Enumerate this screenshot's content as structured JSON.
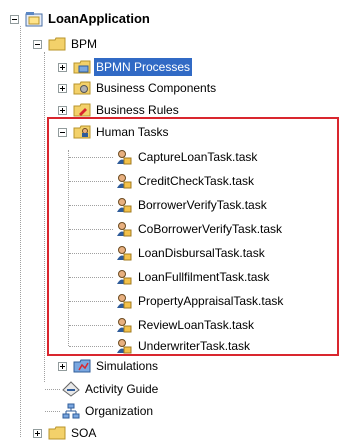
{
  "tree": {
    "root": {
      "label": "LoanApplication",
      "icon": "project-icon"
    },
    "bpm": {
      "label": "BPM",
      "icon": "folder-icon"
    },
    "bpm_children": [
      {
        "label": "BPMN Processes",
        "icon": "bpmn-folder-icon",
        "selected": true
      },
      {
        "label": "Business Components",
        "icon": "components-folder-icon"
      },
      {
        "label": "Business Rules",
        "icon": "rules-folder-icon"
      }
    ],
    "human_tasks": {
      "label": "Human Tasks",
      "icon": "human-tasks-folder-icon"
    },
    "tasks": [
      {
        "label": "CaptureLoanTask.task"
      },
      {
        "label": "CreditCheckTask.task"
      },
      {
        "label": "BorrowerVerifyTask.task"
      },
      {
        "label": "CoBorrowerVerifyTask.task"
      },
      {
        "label": "LoanDisbursalTask.task"
      },
      {
        "label": "LoanFullfilmentTask.task"
      },
      {
        "label": "PropertyAppraisalTask.task"
      },
      {
        "label": "ReviewLoanTask.task"
      },
      {
        "label": "UnderwriterTask.task"
      }
    ],
    "after": [
      {
        "label": "Simulations",
        "icon": "simulations-folder-icon"
      },
      {
        "label": "Activity Guide",
        "icon": "activity-guide-icon"
      },
      {
        "label": "Organization",
        "icon": "organization-icon"
      }
    ],
    "soa": {
      "label": "SOA",
      "icon": "folder-icon"
    }
  },
  "colors": {
    "highlight": "#d9262e",
    "selection": "#316ac5",
    "folder": "#f3d16a"
  }
}
